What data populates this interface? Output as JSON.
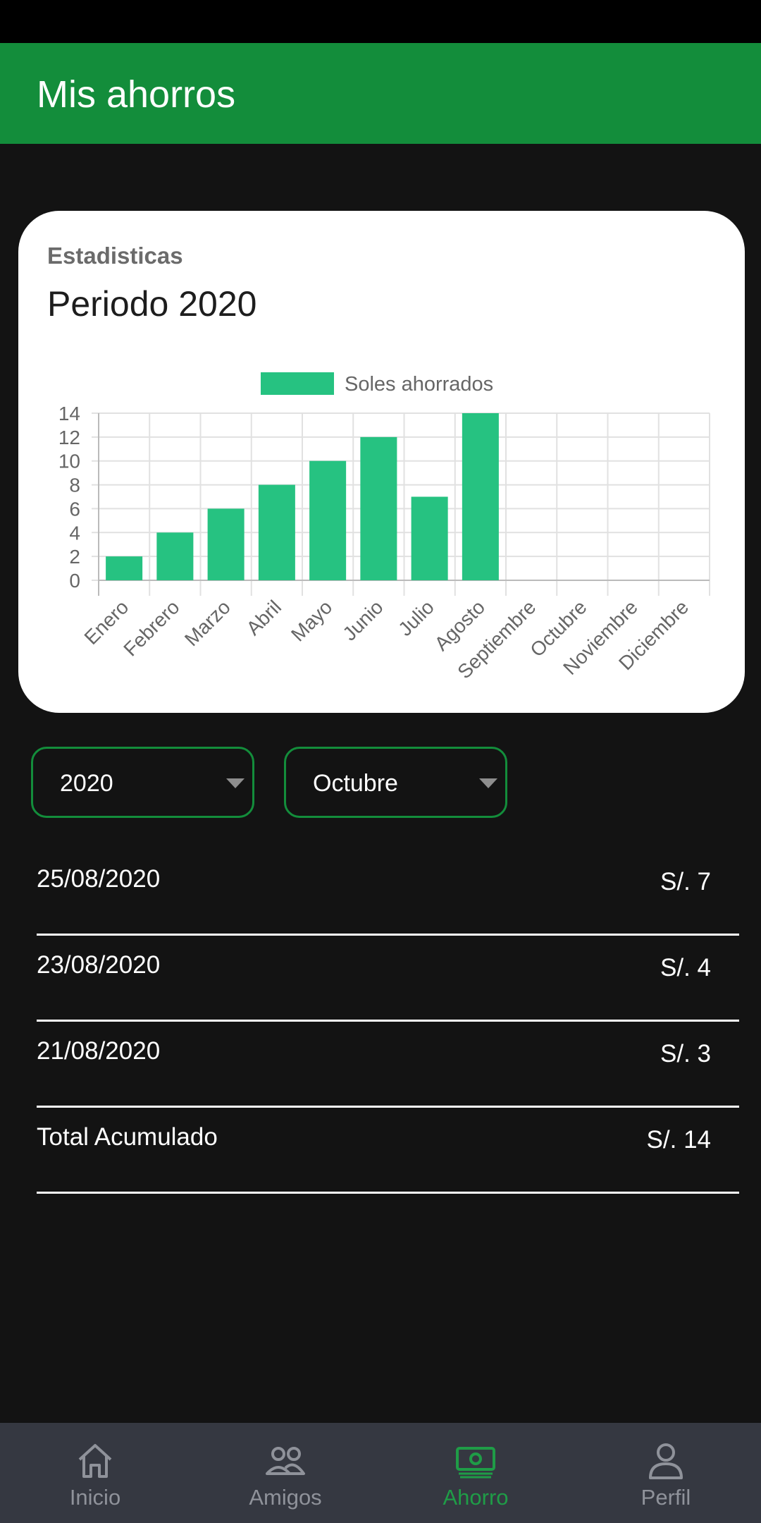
{
  "app_bar": {
    "title": "Mis ahorros"
  },
  "card": {
    "subtitle": "Estadisticas",
    "title": "Periodo 2020"
  },
  "chart_data": {
    "type": "bar",
    "categories": [
      "Enero",
      "Febrero",
      "Marzo",
      "Abril",
      "Mayo",
      "Junio",
      "Julio",
      "Agosto",
      "Septiembre",
      "Octubre",
      "Noviembre",
      "Diciembre"
    ],
    "series": [
      {
        "name": "Soles ahorrados",
        "values": [
          2,
          4,
          6,
          8,
          10,
          12,
          7,
          14,
          0,
          0,
          0,
          0
        ]
      }
    ],
    "ylim": [
      0,
      14
    ],
    "yticks": [
      0,
      2,
      4,
      6,
      8,
      10,
      12,
      14
    ],
    "grid": true,
    "legend_position": "top",
    "bar_color": "#26c281"
  },
  "filters": {
    "year": "2020",
    "month": "Octubre"
  },
  "rows": [
    {
      "date": "25/08/2020",
      "amount": "S/. 7"
    },
    {
      "date": "23/08/2020",
      "amount": "S/. 4"
    },
    {
      "date": "21/08/2020",
      "amount": "S/. 3"
    },
    {
      "date": "Total Acumulado",
      "amount": "S/. 14"
    }
  ],
  "nav": [
    {
      "label": "Inicio",
      "icon": "home-icon"
    },
    {
      "label": "Amigos",
      "icon": "friends-icon"
    },
    {
      "label": "Ahorro",
      "icon": "money-icon",
      "active": true
    },
    {
      "label": "Perfil",
      "icon": "profile-icon"
    }
  ],
  "colors": {
    "primary": "#138d3b",
    "active_nav": "#1f9c47",
    "nav_bg": "#353841",
    "background": "#131313"
  }
}
